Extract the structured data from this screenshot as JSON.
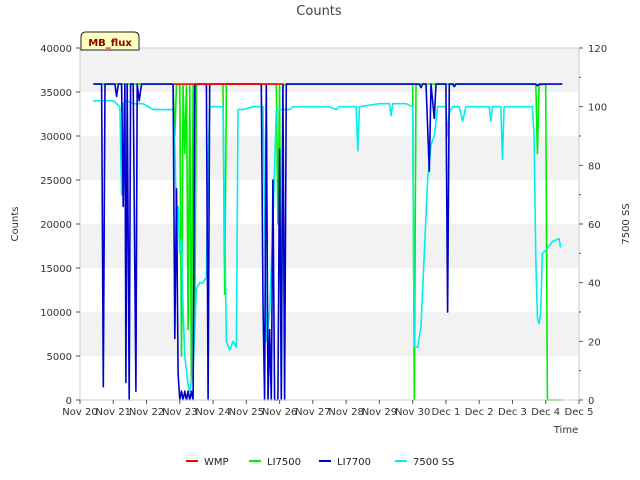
{
  "chart_data": {
    "type": "line",
    "title": "Counts",
    "xlabel": "Time",
    "ylabel": "Counts",
    "y2label": "7500 SS",
    "site_badge": "MB_flux",
    "xlim": [
      0,
      15
    ],
    "ylim": [
      0,
      40000
    ],
    "y2lim": [
      0,
      120
    ],
    "x_ticks": [
      {
        "x": 0,
        "label": "Nov 20"
      },
      {
        "x": 1,
        "label": "Nov 21"
      },
      {
        "x": 2,
        "label": "Nov 22"
      },
      {
        "x": 3,
        "label": "Nov 23"
      },
      {
        "x": 4,
        "label": "Nov 24"
      },
      {
        "x": 5,
        "label": "Nov 25"
      },
      {
        "x": 6,
        "label": "Nov 26"
      },
      {
        "x": 7,
        "label": "Nov 27"
      },
      {
        "x": 8,
        "label": "Nov 28"
      },
      {
        "x": 9,
        "label": "Nov 29"
      },
      {
        "x": 10,
        "label": "Nov 30"
      },
      {
        "x": 11,
        "label": "Dec 1"
      },
      {
        "x": 12,
        "label": "Dec 2"
      },
      {
        "x": 13,
        "label": "Dec 3"
      },
      {
        "x": 14,
        "label": "Dec 4"
      },
      {
        "x": 15,
        "label": "Dec 5"
      }
    ],
    "y_ticks": [
      {
        "v": 0,
        "label": "0"
      },
      {
        "v": 5000,
        "label": "5000"
      },
      {
        "v": 10000,
        "label": "10000"
      },
      {
        "v": 15000,
        "label": "15000"
      },
      {
        "v": 20000,
        "label": "20000"
      },
      {
        "v": 25000,
        "label": "25000"
      },
      {
        "v": 30000,
        "label": "30000"
      },
      {
        "v": 35000,
        "label": "35000"
      },
      {
        "v": 40000,
        "label": "40000"
      }
    ],
    "y2_ticks": [
      {
        "v": 0,
        "label": "0"
      },
      {
        "v": 20,
        "label": "20"
      },
      {
        "v": 40,
        "label": "40"
      },
      {
        "v": 60,
        "label": "60"
      },
      {
        "v": 80,
        "label": "80"
      },
      {
        "v": 100,
        "label": "100"
      },
      {
        "v": 120,
        "label": "120"
      }
    ],
    "grid": "horizontal bands",
    "legend_position": "bottom",
    "series": [
      {
        "name": "WMP",
        "color": "#ff0000",
        "axis": "left",
        "points": [
          [
            2.8,
            35900
          ],
          [
            3.4,
            35900
          ],
          [
            5.5,
            35900
          ],
          [
            6.1,
            35900
          ]
        ]
      },
      {
        "name": "LI7500",
        "color": "#00ee00",
        "axis": "left",
        "points": [
          [
            0.4,
            35900
          ],
          [
            2.75,
            35900
          ],
          [
            2.8,
            35800
          ],
          [
            2.85,
            30000
          ],
          [
            2.9,
            35900
          ],
          [
            3.0,
            35800
          ],
          [
            3.05,
            5000
          ],
          [
            3.1,
            35800
          ],
          [
            3.15,
            28000
          ],
          [
            3.2,
            35800
          ],
          [
            3.25,
            8000
          ],
          [
            3.3,
            35800
          ],
          [
            3.35,
            2000
          ],
          [
            3.4,
            35800
          ],
          [
            3.45,
            9000
          ],
          [
            3.5,
            35800
          ],
          [
            3.6,
            35900
          ],
          [
            4.3,
            35900
          ],
          [
            4.35,
            12000
          ],
          [
            4.4,
            35800
          ],
          [
            4.45,
            35900
          ],
          [
            5.9,
            35900
          ],
          [
            5.95,
            20000
          ],
          [
            6.0,
            35800
          ],
          [
            6.05,
            500
          ],
          [
            6.1,
            35800
          ],
          [
            6.2,
            35900
          ],
          [
            10.0,
            35900
          ],
          [
            10.05,
            0
          ],
          [
            10.1,
            35800
          ],
          [
            10.2,
            35900
          ],
          [
            13.7,
            35900
          ],
          [
            13.75,
            28000
          ],
          [
            13.8,
            35800
          ],
          [
            14.0,
            35900
          ],
          [
            14.05,
            0
          ],
          [
            14.5,
            0
          ]
        ]
      },
      {
        "name": "LI7700",
        "color": "#0000cc",
        "axis": "left",
        "points": [
          [
            0.4,
            35900
          ],
          [
            0.65,
            35900
          ],
          [
            0.7,
            1500
          ],
          [
            0.75,
            35900
          ],
          [
            1.05,
            35900
          ],
          [
            1.1,
            34500
          ],
          [
            1.15,
            35900
          ],
          [
            1.25,
            35900
          ],
          [
            1.3,
            22000
          ],
          [
            1.35,
            35900
          ],
          [
            1.38,
            2000
          ],
          [
            1.42,
            35900
          ],
          [
            1.48,
            0
          ],
          [
            1.52,
            35900
          ],
          [
            1.6,
            35900
          ],
          [
            1.68,
            1000
          ],
          [
            1.72,
            35900
          ],
          [
            1.78,
            34000
          ],
          [
            1.85,
            35900
          ],
          [
            2.8,
            35900
          ],
          [
            2.85,
            7000
          ],
          [
            2.9,
            24000
          ],
          [
            2.95,
            3000
          ],
          [
            3.0,
            0
          ],
          [
            3.05,
            1000
          ],
          [
            3.1,
            0
          ],
          [
            3.15,
            1000
          ],
          [
            3.2,
            0
          ],
          [
            3.25,
            1000
          ],
          [
            3.3,
            0
          ],
          [
            3.35,
            1000
          ],
          [
            3.4,
            0
          ],
          [
            3.45,
            35900
          ],
          [
            3.8,
            35900
          ],
          [
            3.85,
            0
          ],
          [
            3.9,
            35900
          ],
          [
            5.45,
            35900
          ],
          [
            5.5,
            11000
          ],
          [
            5.55,
            0
          ],
          [
            5.6,
            35900
          ],
          [
            5.65,
            0
          ],
          [
            5.7,
            8000
          ],
          [
            5.75,
            0
          ],
          [
            5.8,
            25000
          ],
          [
            5.85,
            0
          ],
          [
            5.95,
            0
          ],
          [
            6.0,
            28500
          ],
          [
            6.05,
            0
          ],
          [
            6.1,
            35900
          ],
          [
            6.15,
            0
          ],
          [
            6.2,
            35900
          ],
          [
            6.3,
            35900
          ],
          [
            10.2,
            35900
          ],
          [
            10.25,
            35500
          ],
          [
            10.3,
            35900
          ],
          [
            10.4,
            35900
          ],
          [
            10.5,
            26000
          ],
          [
            10.55,
            35900
          ],
          [
            10.65,
            32000
          ],
          [
            10.7,
            35900
          ],
          [
            11.0,
            35900
          ],
          [
            11.05,
            10000
          ],
          [
            11.1,
            35900
          ],
          [
            11.2,
            35900
          ],
          [
            11.25,
            35600
          ],
          [
            11.3,
            35900
          ],
          [
            13.7,
            35900
          ],
          [
            13.75,
            35700
          ],
          [
            13.8,
            35900
          ],
          [
            14.5,
            35900
          ]
        ]
      },
      {
        "name": "7500 SS",
        "color": "#00eeee",
        "axis": "right",
        "points": [
          [
            0.4,
            102
          ],
          [
            1.0,
            102
          ],
          [
            1.1,
            101
          ],
          [
            1.2,
            100
          ],
          [
            1.25,
            70
          ],
          [
            1.3,
            101
          ],
          [
            1.4,
            102
          ],
          [
            1.6,
            101
          ],
          [
            1.9,
            101
          ],
          [
            2.2,
            99
          ],
          [
            2.6,
            99
          ],
          [
            2.8,
            99
          ],
          [
            2.85,
            87
          ],
          [
            2.9,
            60
          ],
          [
            2.95,
            66
          ],
          [
            3.0,
            50
          ],
          [
            3.05,
            55
          ],
          [
            3.1,
            30
          ],
          [
            3.15,
            15
          ],
          [
            3.2,
            10
          ],
          [
            3.25,
            5
          ],
          [
            3.3,
            3
          ],
          [
            3.4,
            10
          ],
          [
            3.5,
            38
          ],
          [
            3.6,
            40
          ],
          [
            3.7,
            40
          ],
          [
            3.8,
            42
          ],
          [
            3.85,
            80
          ],
          [
            3.9,
            100
          ],
          [
            4.0,
            100
          ],
          [
            4.1,
            100
          ],
          [
            4.2,
            100
          ],
          [
            4.3,
            100
          ],
          [
            4.4,
            20
          ],
          [
            4.5,
            17
          ],
          [
            4.6,
            20
          ],
          [
            4.7,
            18
          ],
          [
            4.75,
            99
          ],
          [
            4.9,
            99
          ],
          [
            5.2,
            100
          ],
          [
            5.5,
            100
          ],
          [
            5.55,
            65
          ],
          [
            5.6,
            20
          ],
          [
            5.7,
            30
          ],
          [
            5.8,
            60
          ],
          [
            5.9,
            99
          ],
          [
            6.1,
            99
          ],
          [
            6.3,
            99
          ],
          [
            6.4,
            100
          ],
          [
            7.0,
            100
          ],
          [
            7.5,
            100
          ],
          [
            7.7,
            99
          ],
          [
            7.8,
            100
          ],
          [
            8.0,
            100
          ],
          [
            8.3,
            100
          ],
          [
            8.35,
            85
          ],
          [
            8.4,
            100
          ],
          [
            9.0,
            101
          ],
          [
            9.3,
            101
          ],
          [
            9.35,
            97
          ],
          [
            9.4,
            101
          ],
          [
            9.8,
            101
          ],
          [
            10.0,
            100
          ],
          [
            10.05,
            18
          ],
          [
            10.15,
            18
          ],
          [
            10.25,
            25
          ],
          [
            10.35,
            50
          ],
          [
            10.45,
            75
          ],
          [
            10.55,
            87
          ],
          [
            10.65,
            90
          ],
          [
            10.75,
            100
          ],
          [
            10.9,
            100
          ],
          [
            11.0,
            100
          ],
          [
            11.05,
            90
          ],
          [
            11.1,
            98
          ],
          [
            11.2,
            100
          ],
          [
            11.4,
            100
          ],
          [
            11.5,
            95
          ],
          [
            11.6,
            100
          ],
          [
            12.0,
            100
          ],
          [
            12.3,
            100
          ],
          [
            12.35,
            95
          ],
          [
            12.4,
            100
          ],
          [
            12.65,
            100
          ],
          [
            12.7,
            82
          ],
          [
            12.75,
            100
          ],
          [
            13.0,
            100
          ],
          [
            13.3,
            100
          ],
          [
            13.6,
            100
          ],
          [
            13.65,
            90
          ],
          [
            13.7,
            48
          ],
          [
            13.75,
            28
          ],
          [
            13.8,
            26
          ],
          [
            13.85,
            30
          ],
          [
            13.9,
            50
          ],
          [
            14.0,
            51
          ],
          [
            14.2,
            54
          ],
          [
            14.4,
            55
          ],
          [
            14.45,
            52
          ]
        ]
      }
    ]
  },
  "legend": [
    {
      "label": "WMP",
      "color": "#ff0000"
    },
    {
      "label": "LI7500",
      "color": "#00ee00"
    },
    {
      "label": "LI7700",
      "color": "#0000cc"
    },
    {
      "label": "7500 SS",
      "color": "#00eeee"
    }
  ]
}
